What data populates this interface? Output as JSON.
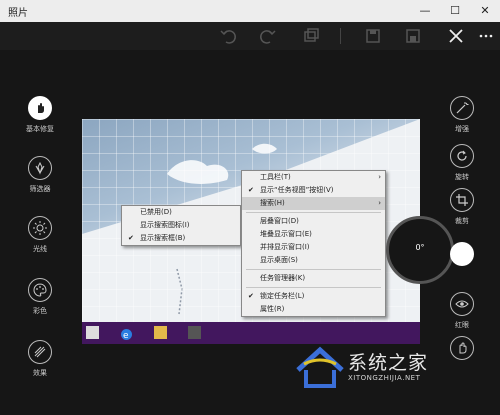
{
  "window": {
    "title": "照片",
    "minimize": "—",
    "maximize": "☐",
    "close": "✕"
  },
  "toolbar": {
    "icons": [
      "undo-icon",
      "redo-icon",
      "copy-icon",
      "save-copy-icon",
      "save-icon",
      "close-icon",
      "more-icon"
    ]
  },
  "left_tools": [
    {
      "label": "基本修复",
      "icon": "hand-icon",
      "active": true
    },
    {
      "label": "筛选器",
      "icon": "filter-icon",
      "active": false
    },
    {
      "label": "光线",
      "icon": "sun-icon",
      "active": false
    },
    {
      "label": "彩色",
      "icon": "palette-icon",
      "active": false
    },
    {
      "label": "效果",
      "icon": "effects-icon",
      "active": false
    }
  ],
  "right_tools": [
    {
      "label": "增强",
      "icon": "magic-wand-icon"
    },
    {
      "label": "旋转",
      "icon": "rotate-icon"
    },
    {
      "label": "裁剪",
      "icon": "crop-icon"
    },
    {
      "label": "红眼",
      "icon": "eye-icon"
    },
    {
      "label": "",
      "icon": "touch-icon"
    }
  ],
  "rotation": {
    "value": "0°"
  },
  "context_menu_left": {
    "items": [
      {
        "label": "已禁用(D)",
        "checked": false
      },
      {
        "label": "显示搜索图标(I)",
        "checked": false
      },
      {
        "label": "显示搜索框(B)",
        "checked": true
      }
    ]
  },
  "context_menu_right": {
    "items": [
      {
        "label": "工具栏(T)",
        "submenu": true
      },
      {
        "label": "显示“任务视图”按钮(V)",
        "checked": true
      },
      {
        "label": "搜索(H)",
        "submenu": true,
        "highlighted": true
      },
      {
        "sep": true
      },
      {
        "label": "层叠窗口(D)"
      },
      {
        "label": "堆叠显示窗口(E)"
      },
      {
        "label": "并排显示窗口(I)"
      },
      {
        "label": "显示桌面(S)"
      },
      {
        "sep": true
      },
      {
        "label": "任务管理器(K)"
      },
      {
        "sep": true
      },
      {
        "label": "锁定任务栏(L)",
        "checked": true
      },
      {
        "label": "属性(R)"
      }
    ]
  },
  "watermark": {
    "text": "系统之家",
    "url": "XITONGZHIJIA.NET"
  },
  "colors": {
    "bg": "#161616",
    "taskbar": "#42175e",
    "menu": "#efefef"
  }
}
